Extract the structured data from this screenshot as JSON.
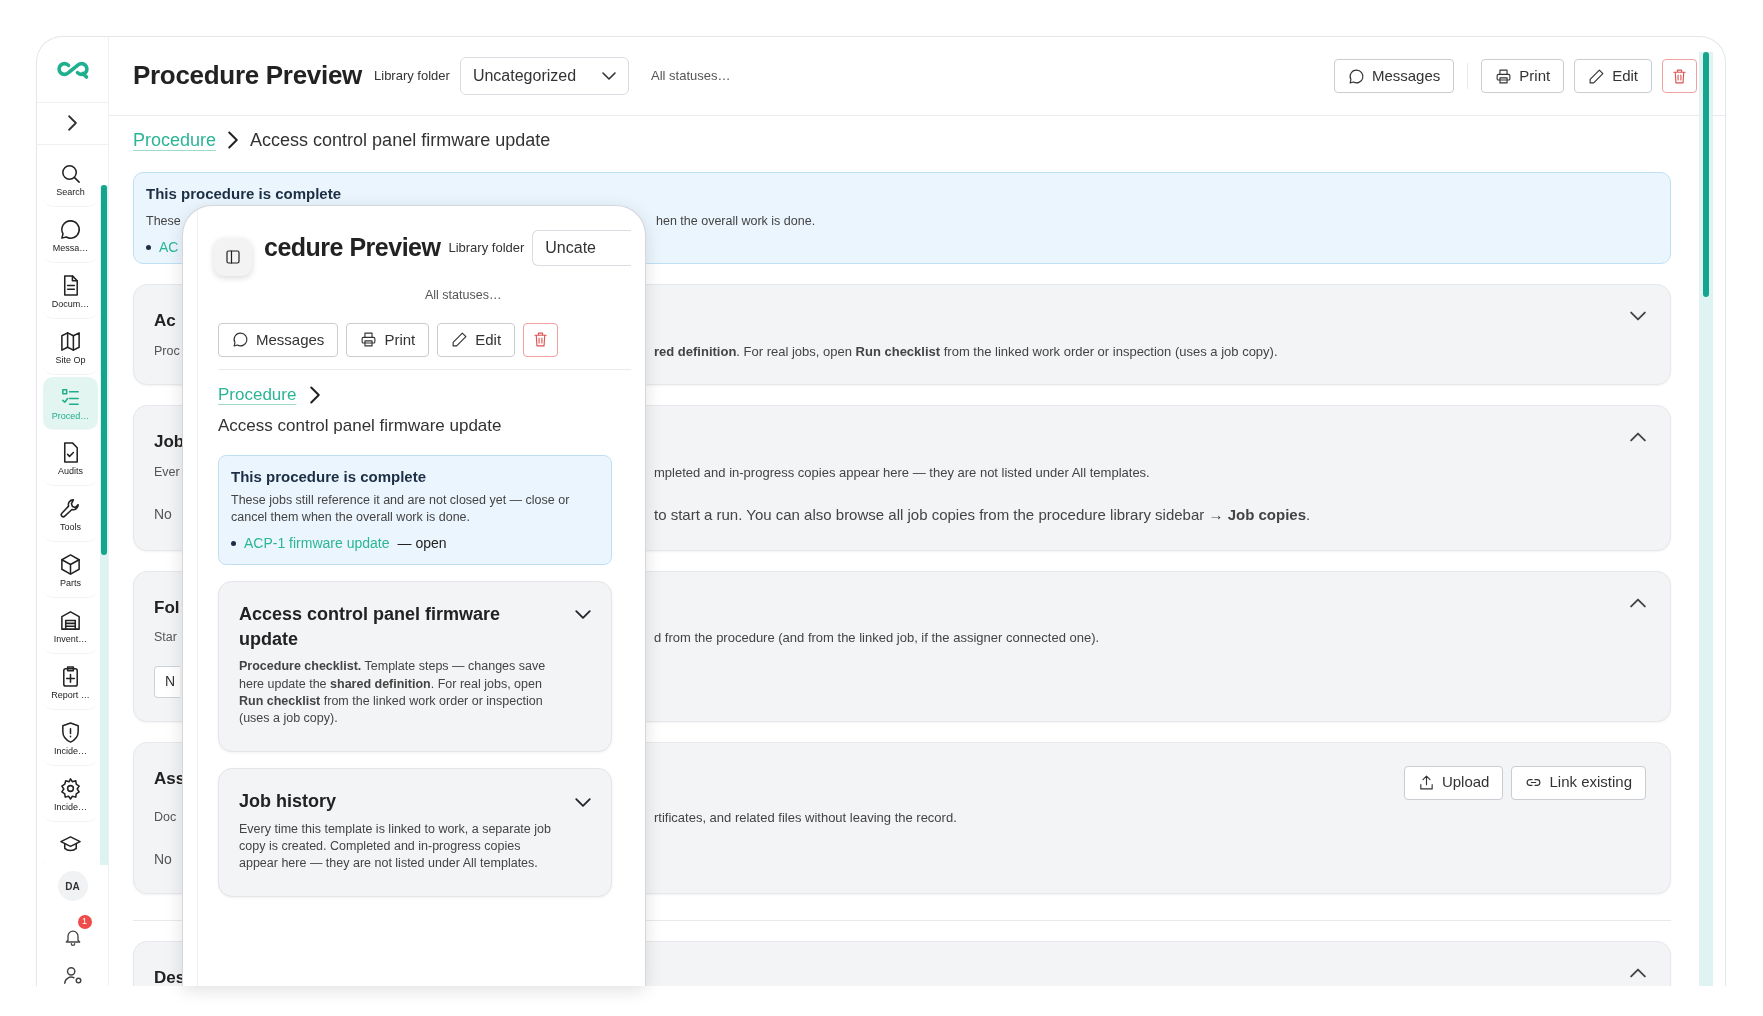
{
  "sidebar": {
    "items": [
      {
        "kind": "search",
        "label": "Search",
        "selected": false
      },
      {
        "kind": "chat",
        "label": "Messa…",
        "selected": false
      },
      {
        "kind": "document",
        "label": "Docum…",
        "selected": false
      },
      {
        "kind": "map",
        "label": "Site Op",
        "selected": false
      },
      {
        "kind": "checklist",
        "label": "Proced…",
        "selected": true
      },
      {
        "kind": "audit",
        "label": "Audits",
        "selected": false
      },
      {
        "kind": "tools",
        "label": "Tools",
        "selected": false
      },
      {
        "kind": "parts",
        "label": "Parts",
        "selected": false
      },
      {
        "kind": "inventory",
        "label": "Invent…",
        "selected": false
      },
      {
        "kind": "report",
        "label": "Report …",
        "selected": false
      },
      {
        "kind": "incident",
        "label": "Incide…",
        "selected": false
      },
      {
        "kind": "settings",
        "label": "Incide…",
        "selected": false
      },
      {
        "kind": "training",
        "selected": false
      }
    ],
    "user_initials": "DA",
    "notification_count": "1"
  },
  "header": {
    "title": "Procedure Preview",
    "folder_label": "Library folder",
    "folder_value": "Uncategorized",
    "status_filter": "All statuses…",
    "buttons": [
      {
        "kind": "messages",
        "label": "Messages"
      },
      {
        "kind": "print",
        "label": "Print"
      },
      {
        "kind": "edit",
        "label": "Edit"
      },
      {
        "kind": "delete"
      }
    ]
  },
  "breadcrumb": {
    "link": "Procedure",
    "current": "Access control panel firmware update"
  },
  "alert": {
    "title": "This procedure is complete",
    "text_left": "These",
    "text_right": "hen the overall work is done.",
    "link_fragment": "AC"
  },
  "sections": [
    {
      "title": "Ac",
      "text": "Proc",
      "right_text": "**red definition**. For real jobs, open **Run checklist** from the linked work order or inspection (uses a job copy).",
      "expanded": false
    },
    {
      "title": "Job",
      "text": "Ever",
      "right_text": "mpleted and in-progress copies appear here — they are not listed under All templates.",
      "note": "No",
      "right_note": "to start a run. You can also browse all job copies from the procedure library sidebar → **Job copies**.",
      "expanded": true
    },
    {
      "title": "Fol",
      "text": "Star",
      "right_text": "d from the procedure (and from the linked job, if the assigner connected one).",
      "control": "N",
      "expanded": true
    },
    {
      "title": "Ass",
      "text": "Doc",
      "right_text": "rtificates, and related files without leaving the record.",
      "note": "No",
      "buttons": [
        {
          "kind": "upload",
          "label": "Upload"
        },
        {
          "kind": "link",
          "label": "Link existing"
        }
      ]
    },
    {
      "title": "Des",
      "expanded": true
    }
  ],
  "overlay": {
    "title": "cedure Preview",
    "folder_label": "Library folder",
    "folder_value": "Uncate",
    "status_filter": "All statuses…",
    "buttons": [
      {
        "kind": "messages",
        "label": "Messages"
      },
      {
        "kind": "print",
        "label": "Print"
      },
      {
        "kind": "edit",
        "label": "Edit"
      },
      {
        "kind": "delete"
      }
    ],
    "breadcrumb": {
      "link": "Procedure",
      "current": "Access control panel firmware update"
    },
    "alert": {
      "title": "This procedure is complete",
      "text": "These jobs still reference it and are not closed yet — close or cancel them when the overall work is done.",
      "items": [
        {
          "link": "ACP-1 firmware update",
          "status": "— open"
        }
      ]
    },
    "sections": [
      {
        "title": "Access control panel firmware update",
        "text": "**Procedure checklist.** Template steps — changes save here update the **shared definition**. For real jobs, open **Run checklist** from the linked work order or inspection (uses a job copy).",
        "expanded": false
      },
      {
        "title": "Job history",
        "text": "Every time this template is linked to work, a separate job copy is created. Completed and in-progress copies appear here — they are not listed under All templates.",
        "expanded": false
      }
    ]
  }
}
